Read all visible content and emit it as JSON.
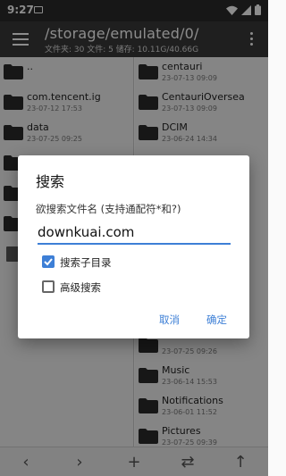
{
  "status": {
    "time": "9:27"
  },
  "toolbar": {
    "path": "/storage/emulated/0/",
    "stats": "文件夹: 30  文件: 5  储存: 10.11G/40.66G"
  },
  "left_pane": {
    "items": [
      {
        "name": "..",
        "date": ""
      },
      {
        "name": "com.tencent.ig",
        "date": "23-07-12 17:53"
      },
      {
        "name": "data",
        "date": "23-07-25 09:25"
      },
      {
        "name": "",
        "date": ""
      },
      {
        "name": "",
        "date": ""
      },
      {
        "name": "",
        "date": ""
      },
      {
        "name": "",
        "date": ""
      }
    ]
  },
  "right_pane": {
    "items": [
      {
        "name": "centauri",
        "date": "23-07-13 09:09"
      },
      {
        "name": "CentauriOversea",
        "date": "23-07-13 09:09"
      },
      {
        "name": "DCIM",
        "date": "23-06-24 14:34"
      },
      {
        "name": "",
        "date": ""
      },
      {
        "name": "",
        "date": ""
      },
      {
        "name": "",
        "date": ""
      },
      {
        "name": "",
        "date": ""
      },
      {
        "name": "",
        "date": ""
      },
      {
        "name": "",
        "date": ""
      },
      {
        "name": "",
        "date": "23-07-25 09:26"
      },
      {
        "name": "Music",
        "date": "23-06-14 15:53"
      },
      {
        "name": "Notifications",
        "date": "23-06-01 11:52"
      },
      {
        "name": "Pictures",
        "date": "23-07-25 09:39"
      }
    ]
  },
  "dialog": {
    "title": "搜索",
    "prompt": "欲搜索文件名 (支持通配符*和?)",
    "input_value": "downkuai.com",
    "option_subdir": {
      "label": "搜索子目录",
      "checked": true
    },
    "option_advanced": {
      "label": "高级搜索",
      "checked": false
    },
    "cancel_label": "取消",
    "ok_label": "确定"
  },
  "colors": {
    "accent": "#3d7fd6",
    "toolbar": "#3a3a3a",
    "statusbar": "#2a2a2a"
  }
}
